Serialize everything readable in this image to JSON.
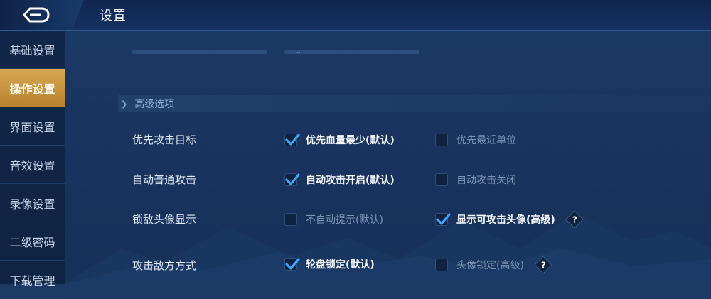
{
  "header": {
    "title": "设置"
  },
  "sidebar": {
    "items": [
      {
        "label": "基础设置",
        "active": false
      },
      {
        "label": "操作设置",
        "active": true
      },
      {
        "label": "界面设置",
        "active": false
      },
      {
        "label": "音效设置",
        "active": false
      },
      {
        "label": "录像设置",
        "active": false
      },
      {
        "label": "二级密码",
        "active": false
      },
      {
        "label": "下载管理",
        "active": false
      }
    ]
  },
  "section": {
    "title": "高级选项"
  },
  "rows": [
    {
      "label": "优先攻击目标",
      "opt1": {
        "label": "优先血量最少(默认)",
        "checked": true
      },
      "opt2": {
        "label": "优先最近单位",
        "checked": false
      }
    },
    {
      "label": "自动普通攻击",
      "opt1": {
        "label": "自动攻击开启(默认)",
        "checked": true
      },
      "opt2": {
        "label": "自动攻击关闭",
        "checked": false
      }
    },
    {
      "label": "锁敌头像显示",
      "opt1": {
        "label": "不自动提示(默认)",
        "checked": false
      },
      "opt2": {
        "label": "显示可攻击头像(高级)",
        "checked": true
      }
    },
    {
      "label": "攻击敌方方式",
      "opt1": {
        "label": "轮盘锁定(默认)",
        "checked": true
      },
      "opt2": {
        "label": "头像锁定(高级)",
        "checked": false
      }
    }
  ],
  "help_symbol": "?",
  "colors": {
    "accent_gold": "#d7a651",
    "check_blue": "#3aa7ff",
    "background": "#1a3460"
  }
}
